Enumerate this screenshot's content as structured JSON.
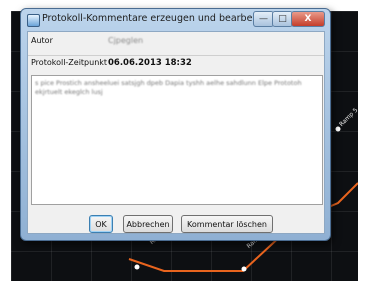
{
  "dialog": {
    "title": "Protokoll-Kommentare erzeugen und bearbeiten",
    "controls": {
      "minimize": "—",
      "maximize": "□",
      "close": "X"
    },
    "author_label": "Autor",
    "author_value": "Cjpeglen",
    "timestamp_label": "Protokoll-Zeitpunkt",
    "timestamp_value": "06.06.2013 18:32",
    "comment_text": "s pice Prostich ansheeluei satsjgh dpeb Dapia tyshh aelhe sahdlunn Elpe Prototoh ekjrtuelt ekeglch lusj",
    "buttons": {
      "ok": "OK",
      "cancel": "Abbrechen",
      "delete": "Kommentar löschen"
    }
  },
  "background": {
    "ramp_labels": [
      "Ramp 5",
      "Ramp 8",
      "Ramp 5"
    ],
    "colors": {
      "canvas": "#0d0f12",
      "line": "#e8641e",
      "point": "#ffffff"
    }
  }
}
